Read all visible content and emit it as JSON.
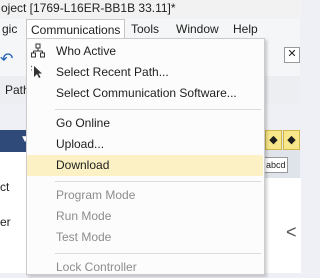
{
  "window": {
    "title": "oject [1769-L16ER-BB1B 33.11]*"
  },
  "menubar": {
    "items": [
      {
        "label": "gic"
      },
      {
        "label": "Communications"
      },
      {
        "label": "Tools"
      },
      {
        "label": "Window"
      },
      {
        "label": "Help"
      }
    ]
  },
  "toolbar": {
    "path_label": "Path"
  },
  "left_panel": {
    "lines": [
      "ct",
      "er"
    ]
  },
  "right_strip": {
    "abcd": "abcd",
    "lt_symbol": "<"
  },
  "communications_menu": {
    "items": [
      {
        "label": "Who Active",
        "icon": "network-tree-icon",
        "enabled": true
      },
      {
        "label": "Select Recent Path...",
        "icon": "recent-path-icon",
        "enabled": true
      },
      {
        "label": "Select Communication Software...",
        "enabled": true
      },
      {
        "label": "Go Online",
        "enabled": true
      },
      {
        "label": "Upload...",
        "enabled": true
      },
      {
        "label": "Download",
        "enabled": true,
        "highlighted": true
      },
      {
        "label": "Program Mode",
        "enabled": false
      },
      {
        "label": "Run Mode",
        "enabled": false
      },
      {
        "label": "Test Mode",
        "enabled": false
      },
      {
        "label": "Lock Controller",
        "enabled": false
      }
    ]
  },
  "colors": {
    "highlight": "#fbf1c4",
    "disabled_text": "#8c8c8c",
    "dark_panel": "#2f4a79",
    "menu_bg": "#fcfcfc"
  }
}
